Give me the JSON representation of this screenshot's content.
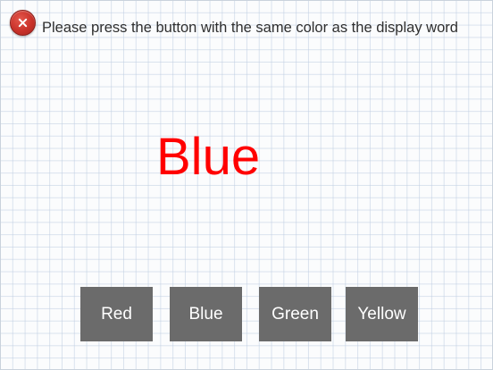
{
  "header": {
    "close_icon": "close-icon",
    "instruction": "Please press the button with the same color as the display word"
  },
  "display": {
    "word": "Blue",
    "color": "#ff0000"
  },
  "answer_buttons": [
    {
      "label": "Red"
    },
    {
      "label": "Blue"
    },
    {
      "label": "Green"
    },
    {
      "label": "Yellow"
    }
  ],
  "colors": {
    "button_bg": "#6b6b6b",
    "button_text": "#ffffff",
    "close_button": "#c9322a"
  }
}
